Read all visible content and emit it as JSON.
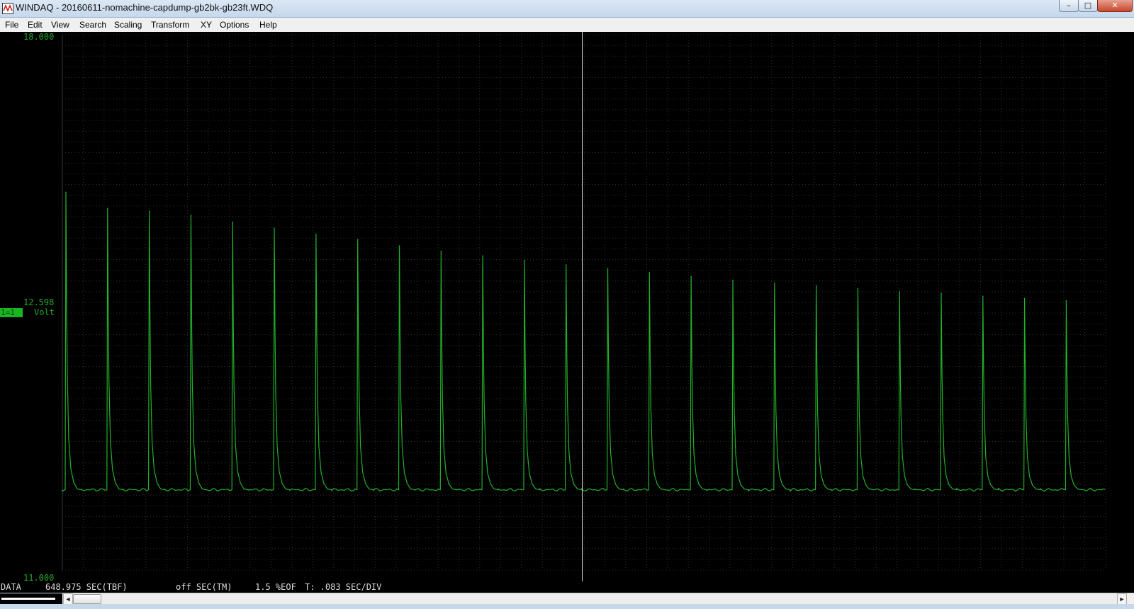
{
  "window": {
    "title": "WINDAQ - 20160611-nomachine-capdump-gb2bk-gb23ft.WDQ",
    "minimize_glyph": "–",
    "maximize_glyph": "□",
    "close_glyph": "✕"
  },
  "menu": {
    "items": [
      {
        "label": "File"
      },
      {
        "label": "Edit"
      },
      {
        "label": "View"
      },
      {
        "label": "Search"
      },
      {
        "label": "Scaling"
      },
      {
        "label": "Transform"
      },
      {
        "label": "XY"
      },
      {
        "label": "Options"
      },
      {
        "label": "Help"
      }
    ]
  },
  "display": {
    "y_max_label": "18.000",
    "y_mid_label": "12.598",
    "y_min_label": "11.000",
    "channel_badge": "1=1",
    "unit_label": "Volt",
    "cursor_fraction": 0.4983
  },
  "status": {
    "mode": "DATA",
    "time_value": "648.975 SEC(TBF)",
    "marker": "off SEC(TM)",
    "eof": "1.5 %EOF",
    "timebase": "T: .083 SEC/DIV"
  },
  "scroll": {
    "progress_fraction": 0.015,
    "left_arrow": "◄",
    "right_arrow": "►"
  },
  "colors": {
    "trace": "#22b02a",
    "grid": "#2e2e2e",
    "background": "#000000",
    "cursor": "#d9d9d9",
    "label": "#21a52b"
  },
  "chart_data": {
    "type": "line",
    "ylim": [
      11.0,
      18.0
    ],
    "baseline": 12.05,
    "spike_count": 25,
    "spike_peaks": [
      15.94,
      15.73,
      15.69,
      15.64,
      15.55,
      15.47,
      15.39,
      15.32,
      15.24,
      15.17,
      15.11,
      15.05,
      14.99,
      14.94,
      14.89,
      14.84,
      14.79,
      14.75,
      14.72,
      14.68,
      14.64,
      14.62,
      14.58,
      14.55,
      14.52
    ]
  }
}
